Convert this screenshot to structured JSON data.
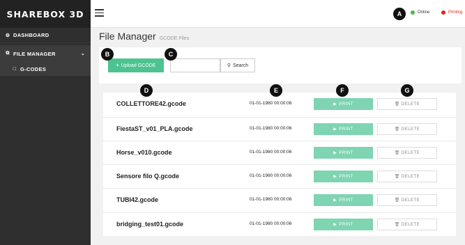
{
  "brand": "SHAREBOX 3D",
  "sidebar": {
    "items": [
      {
        "label": "DASHBOARD",
        "icon": "dashboard-icon"
      },
      {
        "label": "FILE MANAGER",
        "icon": "file-manager-icon"
      },
      {
        "label": "G-CODES",
        "icon": "document-icon"
      }
    ]
  },
  "topbar": {
    "online_label": "Online",
    "printing_label": "Printing",
    "online_color": "#3fbf3f",
    "printing_color": "#d8261f"
  },
  "page": {
    "title": "File Manager",
    "subtitle": "GCODE Files"
  },
  "toolbar": {
    "upload_label": "Upload GCODE",
    "search_value": "",
    "search_label": "Search"
  },
  "files": {
    "print_label": "PRINT",
    "delete_label": "DELETE",
    "rows": [
      {
        "name": "COLLETTORE42.gcode",
        "date": "01-01-1980 00:00:06"
      },
      {
        "name": "FiestaST_v01_PLA.gcode",
        "date": "01-01-1980 00:00:06"
      },
      {
        "name": "Horse_v010.gcode",
        "date": "01-01-1980 00:00:06"
      },
      {
        "name": "Sensore filo Q.gcode",
        "date": "01-01-1980 00:00:06"
      },
      {
        "name": "TUBI42.gcode",
        "date": "01-01-1980 00:00:06"
      },
      {
        "name": "bridging_test01.gcode",
        "date": "01-01-1980 00:00:06"
      }
    ]
  },
  "markers": {
    "a": "A",
    "b": "B",
    "c": "C",
    "d": "D",
    "e": "E",
    "f": "F",
    "g": "G"
  }
}
